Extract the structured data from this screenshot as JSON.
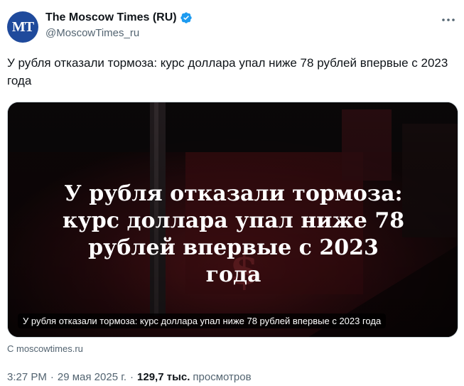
{
  "account": {
    "display_name": "The Moscow Times (RU)",
    "handle": "@MoscowTimes_ru",
    "avatar_text": "MT",
    "verified": true,
    "avatar_color": "#1f4a9c",
    "verified_color": "#1d9bf0"
  },
  "tweet": {
    "text": "У рубля отказали тормоза: курс доллара упал ниже 78 рублей впервые с 2023 года"
  },
  "card": {
    "headline": "У рубля отказали тормоза: курс доллара упал ниже 78 рублей впервые с 2023 года",
    "caption": "У рубля отказали тормоза: курс доллара упал ниже 78 рублей впервые с 2023 года",
    "source": "С moscowtimes.ru"
  },
  "meta": {
    "time": "3:27 PM",
    "separator": "·",
    "date": "29 мая 2025 г.",
    "views_count": "129,7 тыс.",
    "views_label": "просмотров"
  },
  "icons": {
    "more": "more-horizontal-icon",
    "verified": "verified-badge-icon"
  }
}
